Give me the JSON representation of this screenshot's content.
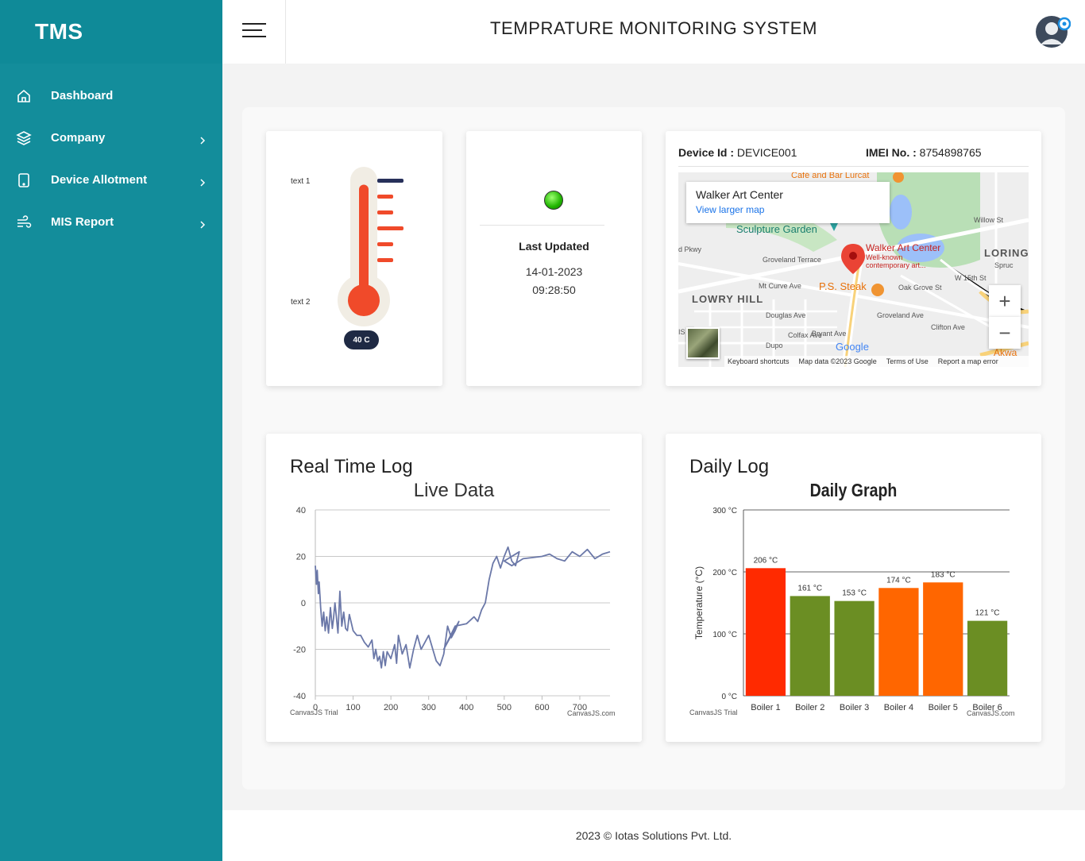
{
  "app": {
    "brand": "TMS",
    "title": "TEMPRATURE MONITORING SYSTEM"
  },
  "sidebar": {
    "items": [
      {
        "label": "Dashboard",
        "icon": "home-icon"
      },
      {
        "label": "Company",
        "icon": "layers-icon"
      },
      {
        "label": "Device Allotment",
        "icon": "tablet-icon"
      },
      {
        "label": "MIS Report",
        "icon": "wind-icon"
      }
    ]
  },
  "thermometer": {
    "label_top": "text 1",
    "label_bottom": "text 2",
    "reading": "40 C",
    "fill_level": 0.95
  },
  "status": {
    "indicator": "green",
    "heading": "Last Updated",
    "date": "14-01-2023",
    "time": "09:28:50"
  },
  "device": {
    "id_label": "Device Id :",
    "id_value": "DEVICE001",
    "imei_label": "IMEI No. :",
    "imei_value": "8754898765"
  },
  "map": {
    "place": "Walker Art Center",
    "link": "View larger map",
    "pin_title": "Walker Art Center",
    "pin_sub1": "Well-known",
    "pin_sub2": "contemporary art...",
    "labels": [
      "Café and Bar Lurcat",
      "Sculpture Garden",
      "LORING",
      "LOWRY HILL",
      "P.S. Steak",
      "Groveland Terrace",
      "Mt Curve Ave",
      "Douglas Ave",
      "Oak Grove St",
      "W 15th St",
      "Groveland Ave",
      "Clifton Ave",
      "Willow St",
      "Colfax Ave",
      "Bryant Ave",
      "Akwa",
      "d Pkwy",
      "Dupo",
      "Spruc",
      "IS"
    ],
    "footer": [
      "Keyboard shortcuts",
      "Map data ©2023 Google",
      "Terms of Use",
      "Report a map error"
    ],
    "google": "Google",
    "zoom_in": "+",
    "zoom_out": "−"
  },
  "realtime": {
    "heading": "Real Time Log",
    "watermark_left": "CanvasJS Trial",
    "watermark_right": "CanvasJS.com"
  },
  "daily": {
    "heading": "Daily Log",
    "watermark_left": "CanvasJS Trial",
    "watermark_right": "CanvasJS.com"
  },
  "chart_data": [
    {
      "type": "line",
      "title": "Live Data",
      "xlabel": "",
      "ylabel": "",
      "xlim": [
        0,
        780
      ],
      "ylim": [
        -40,
        40
      ],
      "x_ticks": [
        0,
        100,
        200,
        300,
        400,
        500,
        600,
        700
      ],
      "y_ticks": [
        -40,
        -20,
        0,
        20,
        40
      ],
      "color": "#6b78a8",
      "x": [
        0,
        3,
        5,
        8,
        10,
        14,
        18,
        22,
        26,
        30,
        35,
        40,
        45,
        48,
        52,
        55,
        60,
        65,
        70,
        75,
        80,
        85,
        90,
        100,
        110,
        120,
        130,
        140,
        150,
        155,
        160,
        165,
        170,
        175,
        180,
        185,
        190,
        200,
        210,
        215,
        220,
        230,
        240,
        250,
        260,
        270,
        280,
        300,
        320,
        330,
        340,
        350,
        360,
        370,
        380,
        340,
        370,
        400,
        420,
        430,
        440,
        450,
        460,
        470,
        480,
        490,
        500,
        510,
        520,
        530,
        540,
        500,
        520,
        550,
        600,
        620,
        640,
        660,
        680,
        700,
        720,
        740,
        760,
        780
      ],
      "y": [
        16,
        8,
        14,
        4,
        9,
        -2,
        -10,
        -4,
        -12,
        -6,
        -13,
        -2,
        -11,
        -7,
        0,
        -5,
        -13,
        5,
        -10,
        -4,
        -11,
        -12,
        -5,
        -12,
        -14,
        -14,
        -17,
        -19,
        -16,
        -24,
        -20,
        -25,
        -23,
        -28,
        -21,
        -27,
        -21,
        -24,
        -18,
        -26,
        -14,
        -22,
        -18,
        -28,
        -20,
        -14,
        -20,
        -14,
        -25,
        -27,
        -22,
        -10,
        -15,
        -12,
        -8,
        -20,
        -10,
        -9,
        -6,
        -8,
        -3,
        0,
        10,
        17,
        20,
        15,
        20,
        24,
        18,
        16,
        22,
        18,
        16,
        19,
        20,
        21,
        19,
        18,
        22,
        20,
        23,
        19,
        21,
        22
      ]
    },
    {
      "type": "bar",
      "title": "Daily Graph",
      "xlabel": "",
      "ylabel": "Temperature (°C)",
      "ylim": [
        0,
        300
      ],
      "y_ticks": [
        0,
        100,
        200,
        300
      ],
      "unit": " °C",
      "categories": [
        "Boiler 1",
        "Boiler 2",
        "Boiler 3",
        "Boiler 4",
        "Boiler 5",
        "Boiler 6"
      ],
      "values": [
        206,
        161,
        153,
        174,
        183,
        121
      ],
      "colors": [
        "#ff2a00",
        "#6b8e23",
        "#6b8e23",
        "#ff6600",
        "#ff6600",
        "#6b8e23"
      ]
    }
  ],
  "footer": {
    "text": "2023 © Iotas Solutions Pvt. Ltd."
  }
}
